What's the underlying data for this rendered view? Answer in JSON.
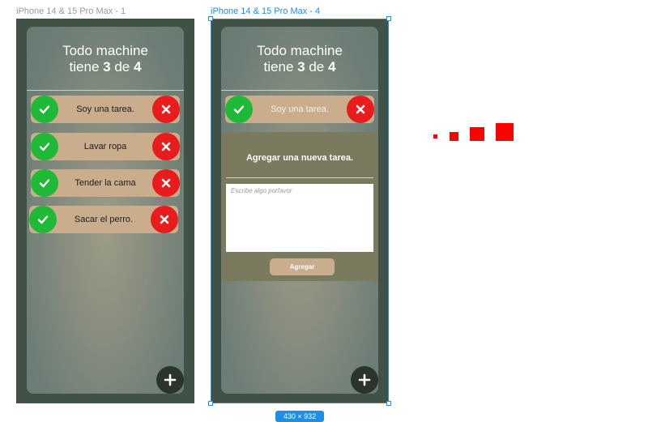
{
  "frames": [
    {
      "label": "iPhone 14 & 15 Pro Max - 1",
      "title_line1": "Todo machine",
      "title_tiene": "tiene ",
      "completed": "3",
      "title_de": " de ",
      "total": "4",
      "todos": [
        {
          "text": "Soy una tarea."
        },
        {
          "text": "Lavar ropa"
        },
        {
          "text": "Tender la cama"
        },
        {
          "text": "Sacar el perro."
        }
      ]
    },
    {
      "label": "iPhone 14 & 15 Pro Max - 4",
      "title_line1": "Todo machine",
      "title_tiene": "tiene ",
      "completed": "3",
      "title_de": " de ",
      "total": "4",
      "todos": [
        {
          "text": "Soy una tarea."
        }
      ],
      "modal": {
        "title": "Agregar una nueva tarea.",
        "placeholder": "Escribe algo porfavor",
        "button": "Agregar"
      }
    }
  ],
  "selection": {
    "size_label": "430 × 932"
  },
  "icons": {
    "check": "check-icon",
    "delete": "close-icon",
    "add": "plus-icon"
  },
  "colors": {
    "check": "#1fb837",
    "delete": "#e81c1c",
    "todo_bg": "#c9ad8d",
    "selection": "#1e8ee6",
    "squares": "#ff0000"
  }
}
